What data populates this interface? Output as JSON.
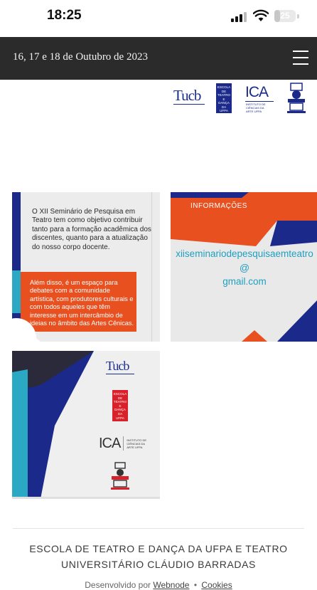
{
  "status_bar": {
    "time": "18:25",
    "battery_level": "25",
    "icons": [
      "signal-icon",
      "wifi-icon",
      "battery-icon"
    ]
  },
  "header": {
    "title": "16, 17 e 18 de Outubro de 2023",
    "menu_icon": "hamburger-menu-icon"
  },
  "logos": {
    "tucb": "Tucb",
    "escola": [
      "ESCOLA",
      "DE",
      "TEATRO",
      "E",
      "DANÇA",
      "DA",
      "UFPA"
    ],
    "ica": "ICA",
    "ica_subtitle": [
      "INSTITUTO DE",
      "CIÊNCIAS DA",
      "ARTE UFPA"
    ]
  },
  "cards": {
    "card1": {
      "paragraph1": "O XII Seminário de Pesquisa em Teatro tem como objetivo contribuir tanto para a formação acadêmica dos discentes, quanto para a atualização do nosso corpo docente.",
      "paragraph2": "Além disso, é um espaço para debates com a comunidade artística, com produtores culturais e com todos aqueles que têm interesse em um intercâmbio de ideias no âmbito das Artes Cênicas."
    },
    "card2": {
      "heading": "INFORMAÇÕES",
      "email_user": "xiiseminariodepesquisaemteatro",
      "email_at": "@",
      "email_domain": "gmail.com"
    },
    "card3": {
      "tucb": "Tucb",
      "escola": [
        "ESCOLA",
        "DE",
        "TEATRO",
        "E",
        "DANÇA",
        "DA",
        "UFPA"
      ],
      "ica": "ICA",
      "ica_subtitle": [
        "INSTITUTO DE",
        "CIÊNCIAS DA",
        "ARTE UFPA"
      ]
    }
  },
  "footer": {
    "line1": "ESCOLA DE TEATRO E DANÇA DA UFPA E TEATRO",
    "line2": "UNIVERSITÁRIO CLÁUDIO BARRADAS",
    "credits_prefix": "Desenvolvido por",
    "credits_link": "Webnode",
    "credits_separator": "•",
    "cookies_link": "Cookies"
  },
  "colors": {
    "header_bg": "#2b2b2b",
    "accent_blue": "#1b2a8a",
    "accent_orange": "#e8501f",
    "accent_teal": "#1f9fbf"
  }
}
